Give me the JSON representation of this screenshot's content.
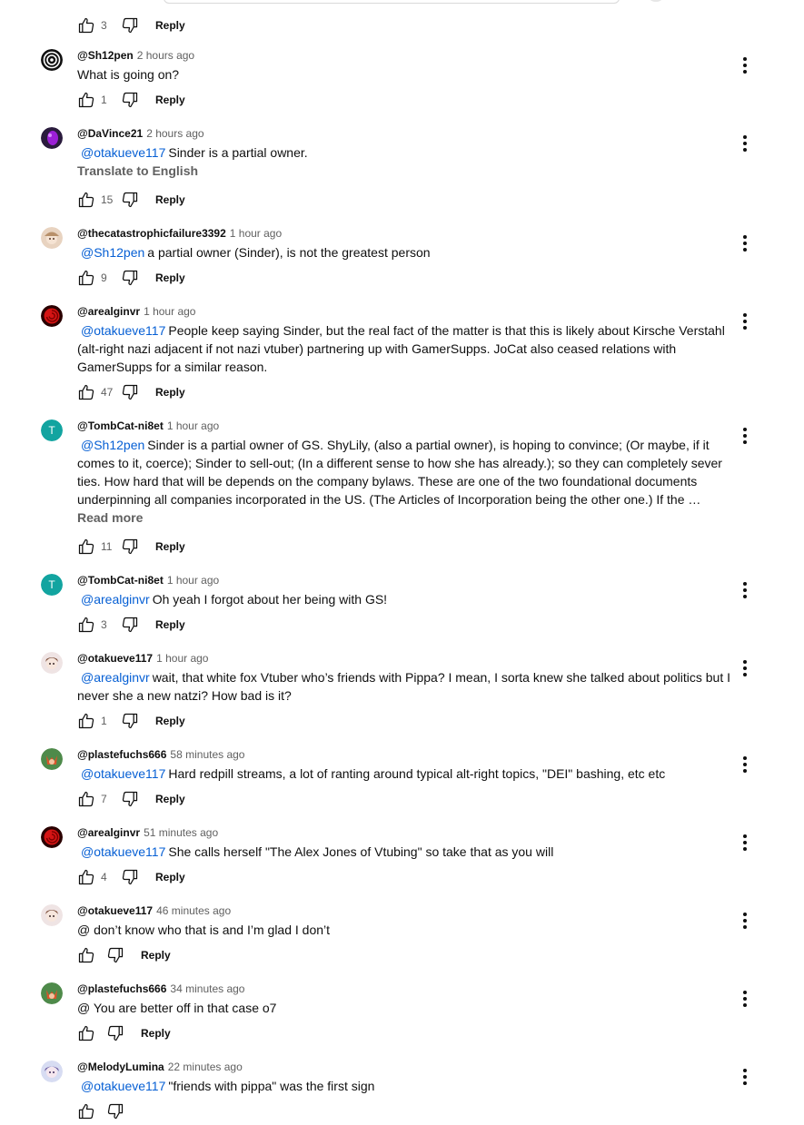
{
  "top_actions": {
    "likes": "3",
    "reply_label": "Reply"
  },
  "comments": [
    {
      "author": "@Sh12pen",
      "time": "2 hours ago",
      "mention": "",
      "text": "What is going on?",
      "extra": "",
      "likes": "1",
      "reply_label": "Reply",
      "avatar": "spiral"
    },
    {
      "author": "@DaVince21",
      "time": "2 hours ago",
      "mention": "@otakueve117",
      "text": "Sinder is a partial owner.",
      "extra": "Translate to English",
      "likes": "15",
      "reply_label": "Reply",
      "avatar": "purple"
    },
    {
      "author": "@thecatastrophicfailure3392",
      "time": "1 hour ago",
      "mention": "@Sh12pen",
      "text": "a partial owner (Sinder), is not the greatest person",
      "extra": "",
      "likes": "9",
      "reply_label": "Reply",
      "avatar": "anime-beige"
    },
    {
      "author": "@arealginvr",
      "time": "1 hour ago",
      "mention": "@otakueve117",
      "text": "People keep saying Sinder, but the real fact of the matter is that this is likely about Kirsche Verstahl (alt-right nazi adjacent if not nazi vtuber) partnering up with GamerSupps. JoCat also ceased relations with GamerSupps for a similar reason.",
      "extra": "",
      "likes": "47",
      "reply_label": "Reply",
      "avatar": "red-rose"
    },
    {
      "author": "@TombCat-ni8et",
      "time": "1 hour ago",
      "mention": "@Sh12pen",
      "text": "Sinder is a partial owner of GS. ShyLily, (also a partial owner), is hoping to convince; (Or maybe, if it comes to it, coerce); Sinder to sell-out; (In a different sense to how she has already.); so they can completely sever ties. How hard that will be depends on the company bylaws. These are one of the two foundational documents underpinning all companies incorporated in the US. (The Articles of Incorporation being the other one.) If the …",
      "extra": "Read more",
      "likes": "11",
      "reply_label": "Reply",
      "avatar": "teal-T",
      "avatar_letter": "T"
    },
    {
      "author": "@TombCat-ni8et",
      "time": "1 hour ago",
      "mention": "@arealginvr",
      "text": "Oh yeah I forgot about her being with GS!",
      "extra": "",
      "likes": "3",
      "reply_label": "Reply",
      "avatar": "teal-T",
      "avatar_letter": "T"
    },
    {
      "author": "@otakueve117",
      "time": "1 hour ago",
      "mention": "@arealginvr",
      "text": "wait, that white fox Vtuber who’s friends with Pippa? I mean, I sorta knew she talked about politics but I never she a new natzi? How bad is it?",
      "extra": "",
      "likes": "1",
      "reply_label": "Reply",
      "avatar": "anime-brown"
    },
    {
      "author": "@plastefuchs666",
      "time": "58 minutes ago",
      "mention": "@otakueve117",
      "text": "Hard redpill streams, a lot of ranting around typical alt-right topics, \"DEI\" bashing, etc etc",
      "extra": "",
      "likes": "7",
      "reply_label": "Reply",
      "avatar": "fox-green"
    },
    {
      "author": "@arealginvr",
      "time": "51 minutes ago",
      "mention": "@otakueve117",
      "text": "She calls herself \"The Alex Jones of Vtubing\" so take that as you will",
      "extra": "",
      "likes": "4",
      "reply_label": "Reply",
      "avatar": "red-rose"
    },
    {
      "author": "@otakueve117",
      "time": "46 minutes ago",
      "mention": "",
      "text": "@ don’t know who that is and I’m glad I don’t",
      "extra": "",
      "likes": "",
      "reply_label": "Reply",
      "avatar": "anime-brown"
    },
    {
      "author": "@plastefuchs666",
      "time": "34 minutes ago",
      "mention": "",
      "text": "@ You are better off in that case o7",
      "extra": "",
      "likes": "",
      "reply_label": "Reply",
      "avatar": "fox-green"
    },
    {
      "author": "@MelodyLumina",
      "time": "22 minutes ago",
      "mention": "@otakueve117",
      "text": "\"friends with pippa\" was the first sign",
      "extra": "",
      "likes": "",
      "reply_label": "",
      "avatar": "anime-purple"
    }
  ]
}
